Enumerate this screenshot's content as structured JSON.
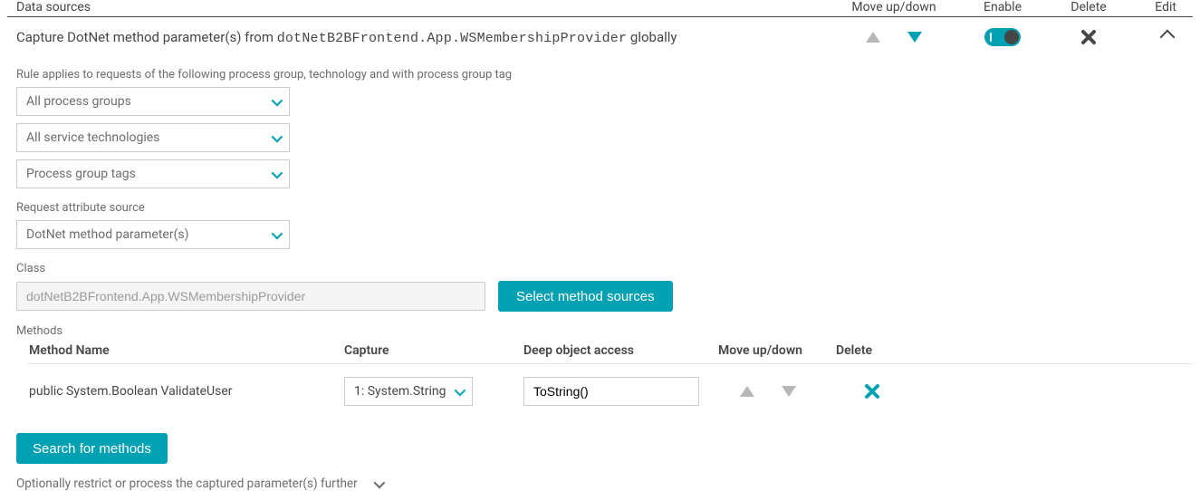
{
  "header": {
    "title": "Data sources",
    "cols": {
      "move": "Move up/down",
      "enable": "Enable",
      "delete": "Delete",
      "edit": "Edit"
    }
  },
  "summary": {
    "prefix": "Capture DotNet method parameter(s) from ",
    "class": "dotNetB2BFrontend.App.WSMembershipProvider",
    "suffix": " globally"
  },
  "form": {
    "rule_label": "Rule applies to requests of the following process group, technology and with process group tag",
    "process_groups_select": "All process groups",
    "technologies_select": "All service technologies",
    "tags_select": "Process group tags",
    "source_label": "Request attribute source",
    "source_select": "DotNet method parameter(s)",
    "class_label": "Class",
    "class_value": "dotNetB2BFrontend.App.WSMembershipProvider",
    "select_sources_btn": "Select method sources",
    "methods_label": "Methods"
  },
  "methods": {
    "headers": {
      "name": "Method Name",
      "capture": "Capture",
      "deep": "Deep object access",
      "move": "Move up/down",
      "delete": "Delete"
    },
    "rows": [
      {
        "name": "public System.Boolean ValidateUser",
        "capture": "1: System.String",
        "deep": "ToString()"
      }
    ]
  },
  "footer": {
    "search_btn": "Search for methods",
    "restrict_text": "Optionally restrict or process the captured parameter(s) further"
  }
}
